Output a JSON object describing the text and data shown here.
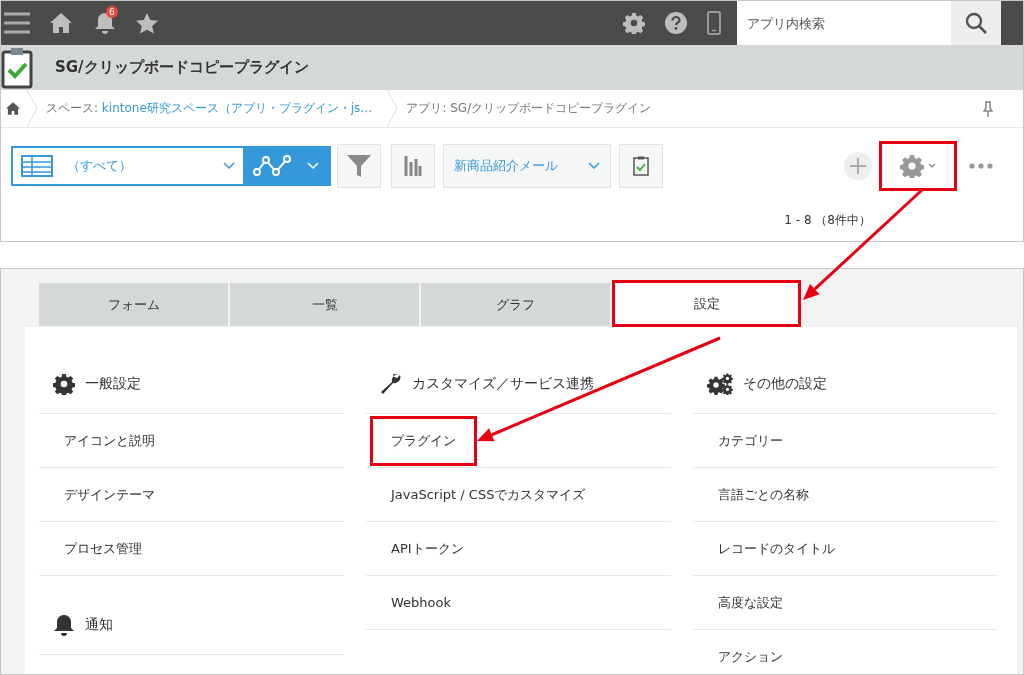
{
  "header": {
    "notification_count": "6",
    "search": {
      "placeholder": "アプリ内検索"
    }
  },
  "app": {
    "title": "SG/クリップボードコピープラグイン"
  },
  "breadcrumb": [
    {
      "prefix": "スペース: ",
      "label": "kintone研究スペース（アプリ・プラグイン・js…"
    },
    {
      "prefix": "アプリ: SG/クリップボードコピープラグイン"
    }
  ],
  "toolbar": {
    "view": "（すべて）",
    "report": "新商品紹介メール",
    "settings_highlighted": true
  },
  "record_count": "1 - 8 （8件中）",
  "tabs": [
    {
      "label": "フォーム",
      "selected": false,
      "highlighted": false
    },
    {
      "label": "一覧",
      "selected": false,
      "highlighted": false
    },
    {
      "label": "グラフ",
      "selected": false,
      "highlighted": false
    },
    {
      "label": "設定",
      "selected": true,
      "highlighted": true
    }
  ],
  "settings_columns": [
    {
      "sections": [
        {
          "heading": "一般設定",
          "kind": "gear",
          "items": [
            {
              "label": "アイコンと説明",
              "highlighted": false
            },
            {
              "label": "デザインテーマ",
              "highlighted": false
            },
            {
              "label": "プロセス管理",
              "highlighted": false
            }
          ]
        },
        {
          "heading": "通知",
          "kind": "bell"
        }
      ]
    },
    {
      "sections": [
        {
          "heading": "カスタマイズ／サービス連携",
          "kind": "wrench",
          "items": [
            {
              "label": "プラグイン",
              "highlighted": true
            },
            {
              "label": "JavaScript / CSSでカスタマイズ",
              "highlighted": false
            },
            {
              "label": "APIトークン",
              "highlighted": false
            },
            {
              "label": "Webhook",
              "highlighted": false
            }
          ]
        }
      ]
    },
    {
      "sections": [
        {
          "heading": "その他の設定",
          "kind": "gears",
          "items": [
            {
              "label": "カテゴリー",
              "highlighted": false
            },
            {
              "label": "言語ごとの名称",
              "highlighted": false
            },
            {
              "label": "レコードのタイトル",
              "highlighted": false
            },
            {
              "label": "高度な設定",
              "highlighted": false
            },
            {
              "label": "アクション",
              "highlighted": false
            }
          ]
        }
      ]
    }
  ]
}
